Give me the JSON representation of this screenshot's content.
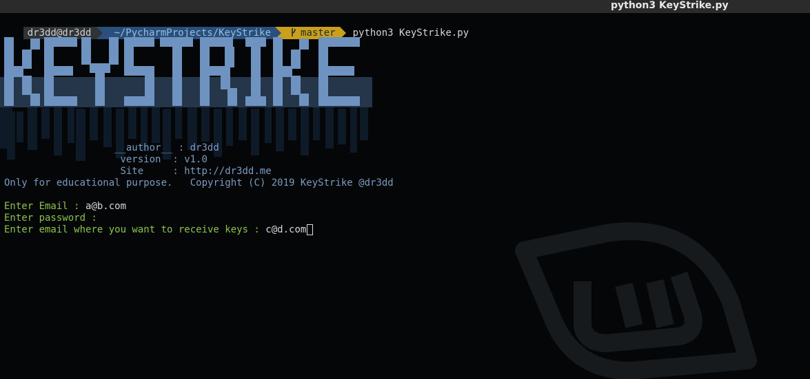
{
  "window": {
    "title": "python3 KeyStrike.py"
  },
  "prompt": {
    "user_host": "dr3dd@dr3dd",
    "path": "~/PycharmProjects/KeyStrike",
    "branch_icon": "git-branch-icon",
    "branch": "master",
    "command": "python3 KeyStrike.py"
  },
  "banner": {
    "logo_text": "KEYSTRIKE",
    "author_label": "__author__",
    "author_sep": ":",
    "author_value": "dr3dd",
    "version_label": "version",
    "version_sep": ":",
    "version_value": "v1.0",
    "site_label": "Site",
    "site_sep": ":",
    "site_value": "http://dr3dd.me",
    "disclaimer": "Only for educational purpose.",
    "copyright": "Copyright (C) 2019 KeyStrike @dr3dd"
  },
  "form": {
    "email_label": "Enter Email : ",
    "email_value": "a@b.com",
    "password_label": "Enter password : ",
    "password_value": "",
    "receive_label": "Enter email where you want to receive keys : ",
    "receive_value": "c@d.com"
  },
  "colors": {
    "banner_blue": "#7a9cc2",
    "prompt_green": "#8bc34a",
    "path_segment": "#2a4f7c",
    "git_segment": "#caa01a"
  }
}
